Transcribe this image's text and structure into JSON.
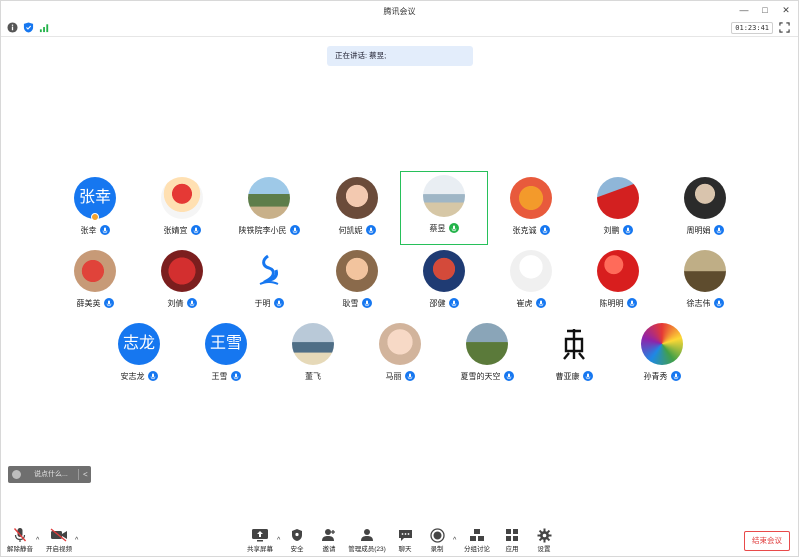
{
  "window": {
    "title": "腾讯会议"
  },
  "infobar": {
    "timer": "01:23:41"
  },
  "speaking": {
    "text": "正在讲话: 蔡昱;"
  },
  "participants": [
    {
      "name": "张幸",
      "avatar_text": "张幸",
      "avatar_icon": "",
      "mic": "on",
      "host": true
    },
    {
      "name": "张婧宜",
      "avatar_text": "",
      "avatar_icon": "mario-photo",
      "mic": "on"
    },
    {
      "name": "陕铁院李小民",
      "avatar_text": "",
      "avatar_icon": "tree-landscape-photo",
      "mic": "on"
    },
    {
      "name": "何凯妮",
      "avatar_text": "",
      "avatar_icon": "girl-photo",
      "mic": "on"
    },
    {
      "name": "蔡昱",
      "avatar_text": "",
      "avatar_icon": "beach-photo",
      "mic": "speaking",
      "active": true
    },
    {
      "name": "张克诚",
      "avatar_text": "",
      "avatar_icon": "tiger-cartoon-photo",
      "mic": "on"
    },
    {
      "name": "刘鹏",
      "avatar_text": "",
      "avatar_icon": "flag-photo",
      "mic": "on"
    },
    {
      "name": "周明娟",
      "avatar_text": "",
      "avatar_icon": "anime-character-photo",
      "mic": "on"
    },
    {
      "name": "薛美英",
      "avatar_text": "",
      "avatar_icon": "plush-toy-photo",
      "mic": "on"
    },
    {
      "name": "刘倩",
      "avatar_text": "",
      "avatar_icon": "red-flowers-photo",
      "mic": "on"
    },
    {
      "name": "于明",
      "avatar_text": "",
      "avatar_icon": "blue-logo",
      "mic": "on"
    },
    {
      "name": "耿雪",
      "avatar_text": "",
      "avatar_icon": "child-photo",
      "mic": "on"
    },
    {
      "name": "邵健",
      "avatar_text": "",
      "avatar_icon": "athlete-photo",
      "mic": "on"
    },
    {
      "name": "崔虎",
      "avatar_text": "",
      "avatar_icon": "cartoon-kid-photo",
      "mic": "on"
    },
    {
      "name": "陈明明",
      "avatar_text": "",
      "avatar_icon": "china-flag-photo",
      "mic": "on"
    },
    {
      "name": "徐志伟",
      "avatar_text": "",
      "avatar_icon": "field-photo",
      "mic": "on"
    },
    {
      "name": "安志龙",
      "avatar_text": "志龙",
      "avatar_icon": "",
      "mic": "on"
    },
    {
      "name": "王雪",
      "avatar_text": "王雪",
      "avatar_icon": "",
      "mic": "on"
    },
    {
      "name": "董飞",
      "avatar_text": "",
      "avatar_icon": "sea-sunset-photo",
      "mic": "none"
    },
    {
      "name": "马丽",
      "avatar_text": "",
      "avatar_icon": "baby-photo",
      "mic": "on"
    },
    {
      "name": "夏雪的天空",
      "avatar_text": "",
      "avatar_icon": "horses-photo",
      "mic": "on"
    },
    {
      "name": "曹亚康",
      "avatar_text": "",
      "avatar_icon": "calligraphy-logo",
      "mic": "on"
    },
    {
      "name": "孙青秀",
      "avatar_text": "",
      "avatar_icon": "balloons-photo",
      "mic": "on"
    }
  ],
  "chat": {
    "placeholder": "说点什么...",
    "collapse": "<"
  },
  "toolbar": {
    "unmute": "解除静音",
    "start_video": "开启视频",
    "share_screen": "共享屏幕",
    "security": "安全",
    "invite": "邀请",
    "manage_members": "管理成员(23)",
    "chat": "聊天",
    "record": "录制",
    "breakout": "分组讨论",
    "apps": "应用",
    "settings": "设置",
    "end_meeting": "结束会议",
    "caret": "^"
  },
  "colors": {
    "accent": "#1677f0",
    "speaking_border": "#27c05a",
    "end": "#e03c3c"
  }
}
